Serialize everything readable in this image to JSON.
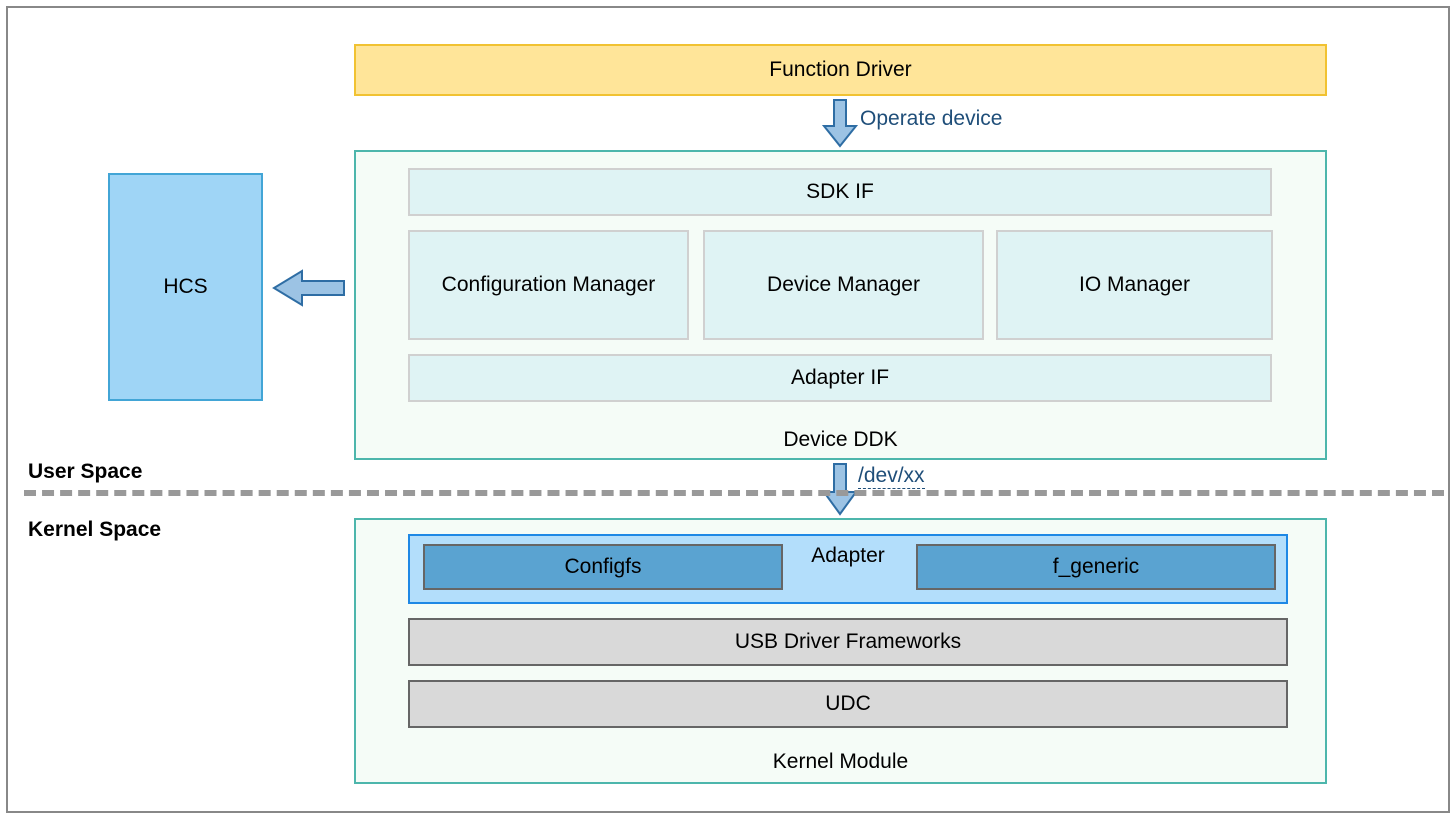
{
  "functionDriver": "Function Driver",
  "operateDevice": "Operate device",
  "hcs": "HCS",
  "deviceDdk": "Device DDK",
  "sdkIf": "SDK IF",
  "configMgr": "Configuration Manager",
  "deviceMgr": "Device Manager",
  "ioMgr": "IO Manager",
  "adapterIf": "Adapter IF",
  "userSpace": "User Space",
  "kernelSpace": "Kernel Space",
  "devxx": "/dev/xx",
  "kernelModule": "Kernel Module",
  "adapter": "Adapter",
  "configfs": "Configfs",
  "fgeneric": "f_generic",
  "usbFrameworks": "USB Driver Frameworks",
  "udc": "UDC"
}
